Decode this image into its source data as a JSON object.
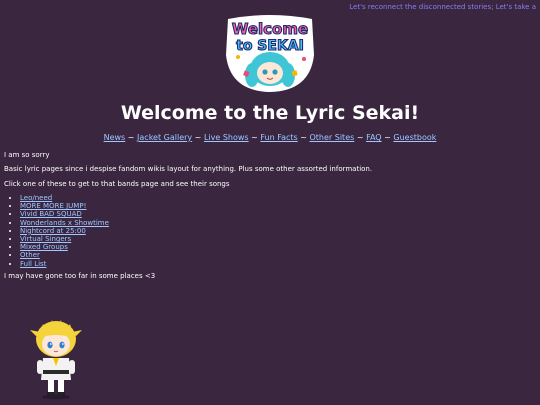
{
  "marquee": "Let's reconnect the disconnected stories; Let's take a",
  "logo": {
    "line1": "Welcome",
    "line2": "to SEKAI"
  },
  "title": "Welcome to the Lyric Sekai!",
  "nav": {
    "items": [
      "News",
      "Jacket Gallery",
      "Live Shows",
      "Fun Facts",
      "Other Sites",
      "FAQ",
      "Guestbook"
    ],
    "separator": " ~ "
  },
  "intro": {
    "line1": "I am so sorry",
    "line2": "Basic lyric pages since i despise fandom wikis layout for anything. Plus some other assorted information.",
    "line3": "Click one of these to get to that bands page and see their songs"
  },
  "bands": [
    "Leo/need",
    "MORE MORE JUMP!",
    "Vivid BAD SQUAD",
    "Wonderlands x Showtime",
    "Nightcord at 25:00",
    "Virtual Singers",
    "Mixed Groups",
    "Other",
    "Full List"
  ],
  "outro": "I may have gone too far in some places <3",
  "colors": {
    "background": "#3b2640",
    "link": "#9ec8ff",
    "marquee": "#8a7cf0"
  }
}
